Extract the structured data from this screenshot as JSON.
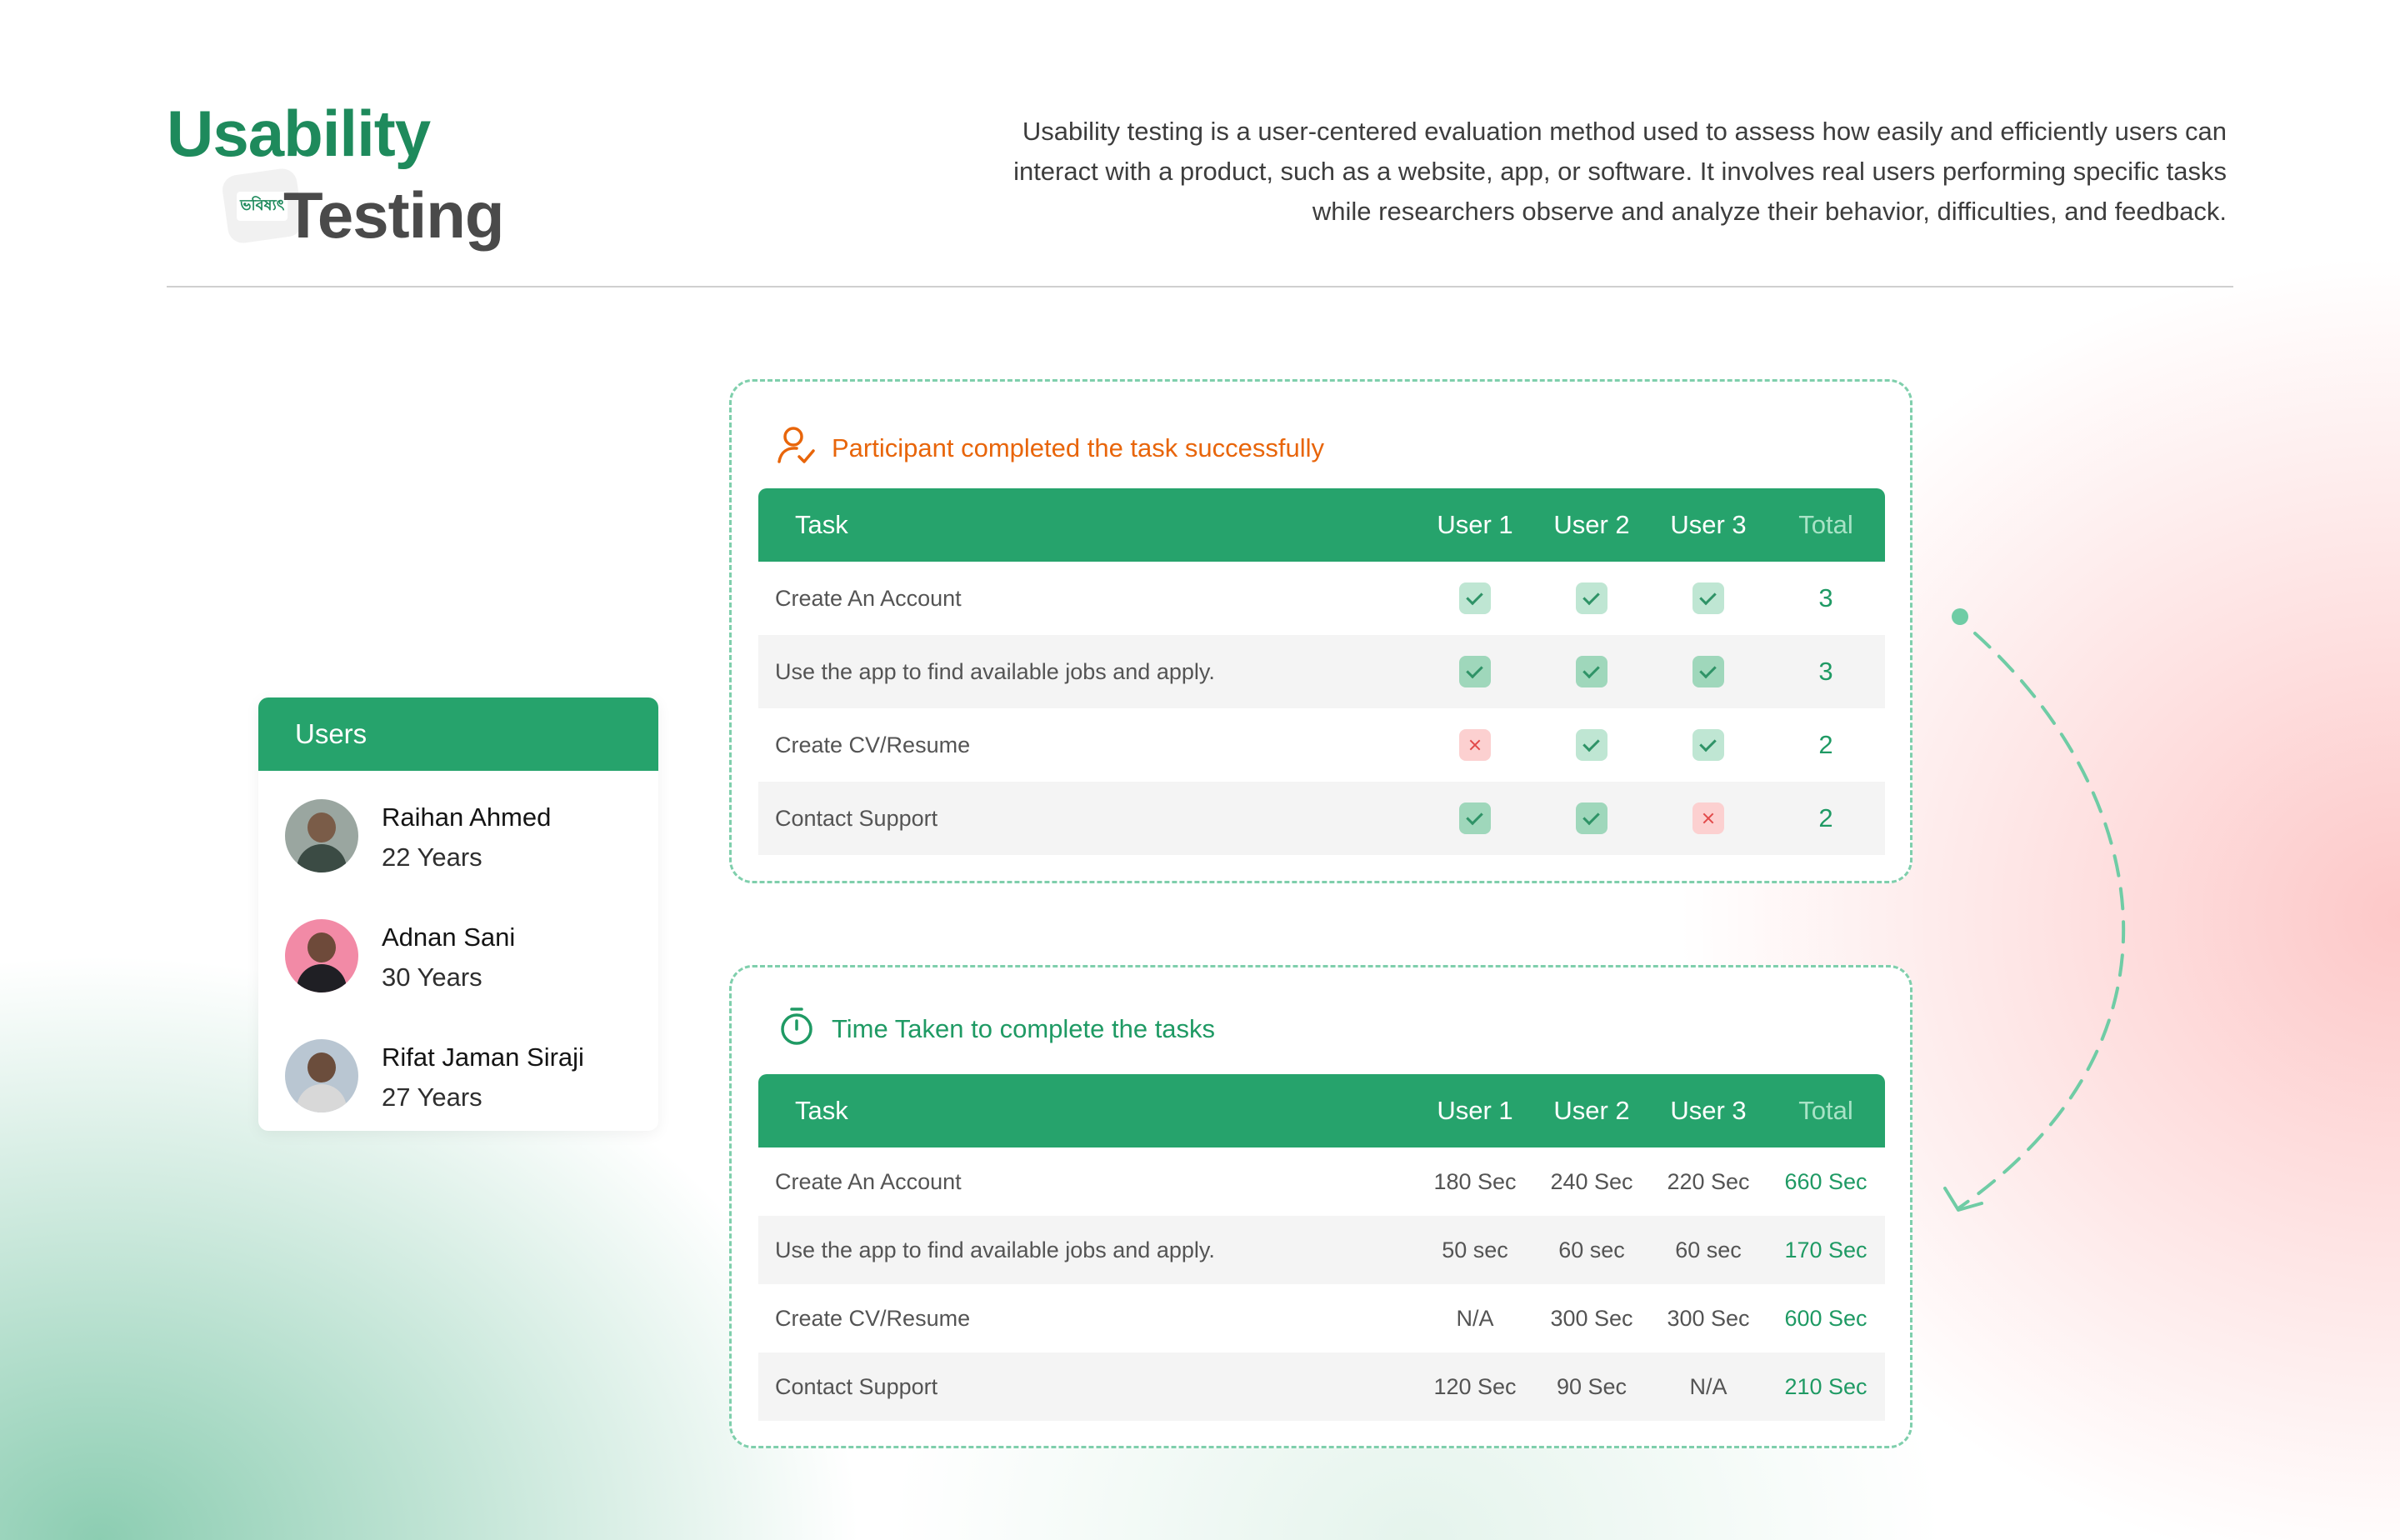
{
  "header": {
    "title_line1": "Usability",
    "title_line2": "Testing",
    "logo_text": "ভবিষ্যৎ",
    "description": "Usability testing is a user-centered evaluation method used to assess how easily and efficiently users can interact with a product, such as a website, app, or software. It involves real users performing specific tasks while researchers observe and analyze their behavior, difficulties, and feedback."
  },
  "users": {
    "title": "Users",
    "items": [
      {
        "name": "Raihan Ahmed",
        "age": "22 Years"
      },
      {
        "name": "Adnan Sani",
        "age": "30 Years"
      },
      {
        "name": "Rifat Jaman Siraji",
        "age": "27 Years"
      }
    ]
  },
  "success_panel": {
    "title": "Participant completed the task successfully",
    "columns": [
      "Task",
      "User 1",
      "User 2",
      "User 3",
      "Total"
    ],
    "rows": [
      {
        "task": "Create An Account",
        "results": [
          "pass",
          "pass",
          "pass"
        ],
        "total": "3"
      },
      {
        "task": "Use the app to find available jobs and apply.",
        "results": [
          "pass",
          "pass",
          "pass"
        ],
        "total": "3"
      },
      {
        "task": "Create CV/Resume",
        "results": [
          "fail",
          "pass",
          "pass"
        ],
        "total": "2"
      },
      {
        "task": "Contact Support",
        "results": [
          "pass",
          "pass",
          "fail"
        ],
        "total": "2"
      }
    ]
  },
  "time_panel": {
    "title": "Time Taken to complete the tasks",
    "columns": [
      "Task",
      "User 1",
      "User 2",
      "User 3",
      "Total"
    ],
    "rows": [
      {
        "task": "Create An Account",
        "times": [
          "180 Sec",
          "240 Sec",
          "220 Sec"
        ],
        "total": "660 Sec"
      },
      {
        "task": "Use the app to find available jobs and apply.",
        "times": [
          "50 sec",
          "60 sec",
          "60 sec"
        ],
        "total": "170 Sec"
      },
      {
        "task": "Create CV/Resume",
        "times": [
          "N/A",
          "300 Sec",
          "300 Sec"
        ],
        "total": "600 Sec"
      },
      {
        "task": "Contact Support",
        "times": [
          "120 Sec",
          "90 Sec",
          "N/A"
        ],
        "total": "210 Sec"
      }
    ]
  },
  "colors": {
    "brand_green": "#26a36c",
    "title_green": "#1e8a5c",
    "accent_orange": "#e8650a",
    "pass": "#bfe6d3",
    "fail": "#fcd0d0"
  },
  "icons": {
    "success_panel": "user-check-icon",
    "time_panel": "stopwatch-icon",
    "pass": "check-icon",
    "fail": "x-icon"
  }
}
